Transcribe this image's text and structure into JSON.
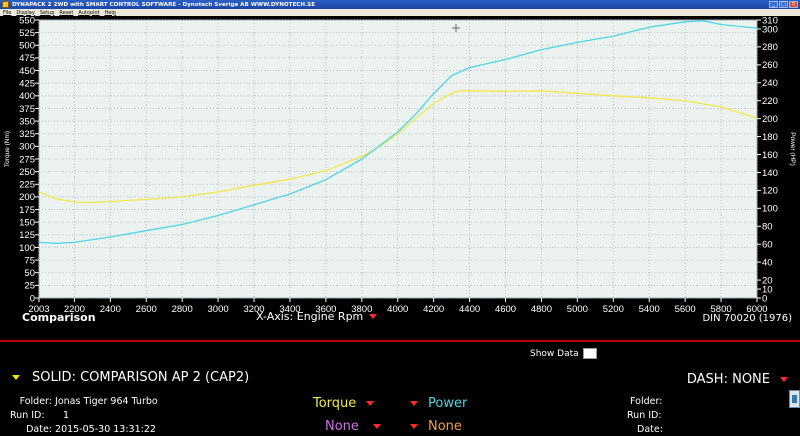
{
  "window": {
    "title": "DYNAPACK 2 2WD with SMART CONTROL SOFTWARE - Dynotech Sverige AB   WWW.DYNOTECH.SE",
    "menu": [
      "File",
      "Display",
      "Setup",
      "Reset",
      "Autoplot",
      "Help"
    ]
  },
  "graph_footer": {
    "left_label": "Comparison",
    "x_axis_label": "X-Axis: Engine Rpm",
    "din": "DIN 70020 (1976)"
  },
  "show_data_label": "Show Data",
  "solid_label": "SOLID: COMPARISON AP 2 (CAP2)",
  "dash_label": "DASH: NONE",
  "run_info": {
    "folder_label": "Folder:",
    "folder_value": "Jonas Tiger 964 Turbo",
    "run_label": "Run ID:",
    "run_value": "1",
    "date_label": "Date:",
    "date_value": "2015-05-30 13:31:22"
  },
  "dash_info": {
    "folder_label": "Folder:",
    "run_label": "Run ID:",
    "date_label": "Date:"
  },
  "channels": {
    "left_top": "Torque",
    "right_top": "Power",
    "left_bottom": "None",
    "right_bottom": "None"
  },
  "colors": {
    "torque": "#f2e84a",
    "power": "#4fd6e6",
    "none_left": "#d070e6",
    "none_right": "#f0a040",
    "accent_red": "#ff2a2a",
    "separator": "#c00000"
  },
  "chart_data": {
    "type": "line",
    "xlabel": "",
    "x_ticks": [
      2003,
      2200,
      2400,
      2600,
      2800,
      3000,
      3200,
      3400,
      3600,
      3800,
      4000,
      4200,
      4400,
      4600,
      4800,
      5000,
      5200,
      5400,
      5600,
      5800,
      6000
    ],
    "xlim": [
      2003,
      6000
    ],
    "y_left": {
      "label": "Torque (Nm)",
      "lim": [
        0,
        550
      ],
      "ticks": [
        0,
        25,
        50,
        75,
        100,
        125,
        150,
        175,
        200,
        225,
        250,
        275,
        300,
        325,
        350,
        375,
        400,
        425,
        450,
        475,
        500,
        525,
        550
      ]
    },
    "y_right": {
      "label": "Power (HP)",
      "lim": [
        0,
        310
      ],
      "ticks": [
        0,
        10,
        20,
        40,
        60,
        80,
        100,
        120,
        140,
        160,
        180,
        200,
        220,
        240,
        260,
        280,
        300,
        310
      ]
    },
    "grid": true,
    "series": [
      {
        "name": "Torque",
        "axis": "left",
        "x": [
          2003,
          2100,
          2200,
          2300,
          2400,
          2600,
          2800,
          3000,
          3200,
          3400,
          3600,
          3800,
          3900,
          4000,
          4100,
          4200,
          4300,
          4350,
          4400,
          4600,
          4800,
          5000,
          5200,
          5400,
          5600,
          5800,
          6000
        ],
        "values": [
          210,
          196,
          190,
          189,
          191,
          195,
          200,
          210,
          223,
          235,
          252,
          280,
          300,
          325,
          355,
          385,
          405,
          410,
          410,
          409,
          410,
          405,
          400,
          396,
          390,
          378,
          356
        ]
      },
      {
        "name": "Power",
        "axis": "right",
        "x": [
          2003,
          2100,
          2200,
          2400,
          2600,
          2800,
          3000,
          3200,
          3400,
          3600,
          3800,
          3900,
          4000,
          4100,
          4200,
          4300,
          4400,
          4600,
          4800,
          5000,
          5200,
          5400,
          5600,
          5700,
          5800,
          6000
        ],
        "values": [
          62,
          61,
          62,
          68,
          75,
          82,
          92,
          104,
          116,
          132,
          155,
          170,
          185,
          205,
          228,
          248,
          257,
          266,
          277,
          285,
          292,
          302,
          308,
          309,
          305,
          301
        ]
      }
    ]
  }
}
